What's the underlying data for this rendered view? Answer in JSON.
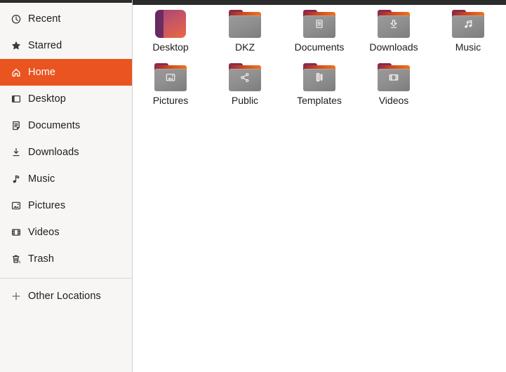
{
  "colors": {
    "accent": "#E95420",
    "titlebar_remnant": "#2B2B2B",
    "sidebar_bg": "#F7F6F5",
    "sidebar_border": "#D5D0CB",
    "folder_front_gray": "#8E8E8E",
    "folder_back_orange": "#E4571F",
    "folder_tab_maroon": "#7E2448",
    "selected_text": "#FFFFFF",
    "text": "#1C1C1C"
  },
  "sidebar": {
    "items": [
      {
        "label": "Recent",
        "icon": "recent-icon",
        "selected": false
      },
      {
        "label": "Starred",
        "icon": "starred-icon",
        "selected": false
      },
      {
        "label": "Home",
        "icon": "home-icon",
        "selected": true
      },
      {
        "label": "Desktop",
        "icon": "desktop-icon",
        "selected": false
      },
      {
        "label": "Documents",
        "icon": "documents-icon",
        "selected": false
      },
      {
        "label": "Downloads",
        "icon": "downloads-icon",
        "selected": false
      },
      {
        "label": "Music",
        "icon": "music-icon",
        "selected": false
      },
      {
        "label": "Pictures",
        "icon": "pictures-icon",
        "selected": false
      },
      {
        "label": "Videos",
        "icon": "videos-icon",
        "selected": false
      },
      {
        "label": "Trash",
        "icon": "trash-icon",
        "selected": false
      }
    ],
    "footer_item": {
      "label": "Other Locations",
      "icon": "plus-icon"
    }
  },
  "main": {
    "items": [
      {
        "label": "Desktop",
        "icon": "desktop-gradient-icon",
        "type": "desktop-tile"
      },
      {
        "label": "DKZ",
        "icon": "plain-folder-icon",
        "type": "folder"
      },
      {
        "label": "Documents",
        "icon": "folder-documents-icon",
        "type": "folder"
      },
      {
        "label": "Downloads",
        "icon": "folder-downloads-icon",
        "type": "folder"
      },
      {
        "label": "Music",
        "icon": "folder-music-icon",
        "type": "folder"
      },
      {
        "label": "Pictures",
        "icon": "folder-pictures-icon",
        "type": "folder"
      },
      {
        "label": "Public",
        "icon": "folder-public-icon",
        "type": "folder"
      },
      {
        "label": "Templates",
        "icon": "folder-templates-icon",
        "type": "folder"
      },
      {
        "label": "Videos",
        "icon": "folder-videos-icon",
        "type": "folder"
      }
    ]
  }
}
